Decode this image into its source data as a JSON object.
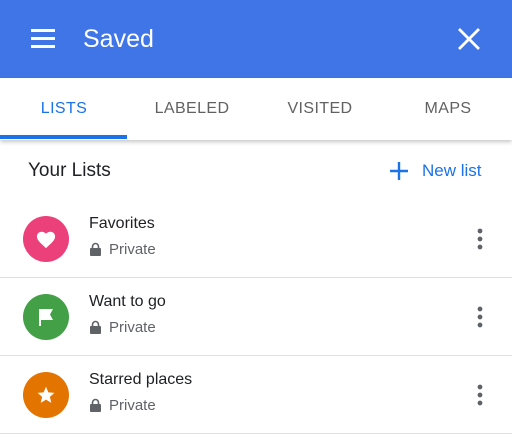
{
  "header": {
    "title": "Saved",
    "menu_icon": "menu-icon",
    "close_icon": "close-icon",
    "background": "#4075e8"
  },
  "tabs": [
    {
      "label": "LISTS",
      "active": true
    },
    {
      "label": "LABELED",
      "active": false
    },
    {
      "label": "VISITED",
      "active": false
    },
    {
      "label": "MAPS",
      "active": false
    }
  ],
  "lists_section": {
    "title": "Your Lists",
    "new_list_label": "New list",
    "new_list_icon": "plus-icon"
  },
  "lists": [
    {
      "name": "Favorites",
      "privacy": "Private",
      "icon": "heart-icon",
      "color": "#ec407a"
    },
    {
      "name": "Want to go",
      "privacy": "Private",
      "icon": "flag-icon",
      "color": "#43a047"
    },
    {
      "name": "Starred places",
      "privacy": "Private",
      "icon": "star-icon",
      "color": "#e37400"
    }
  ],
  "colors": {
    "accent": "#1a73e8",
    "header": "#4075e8"
  }
}
